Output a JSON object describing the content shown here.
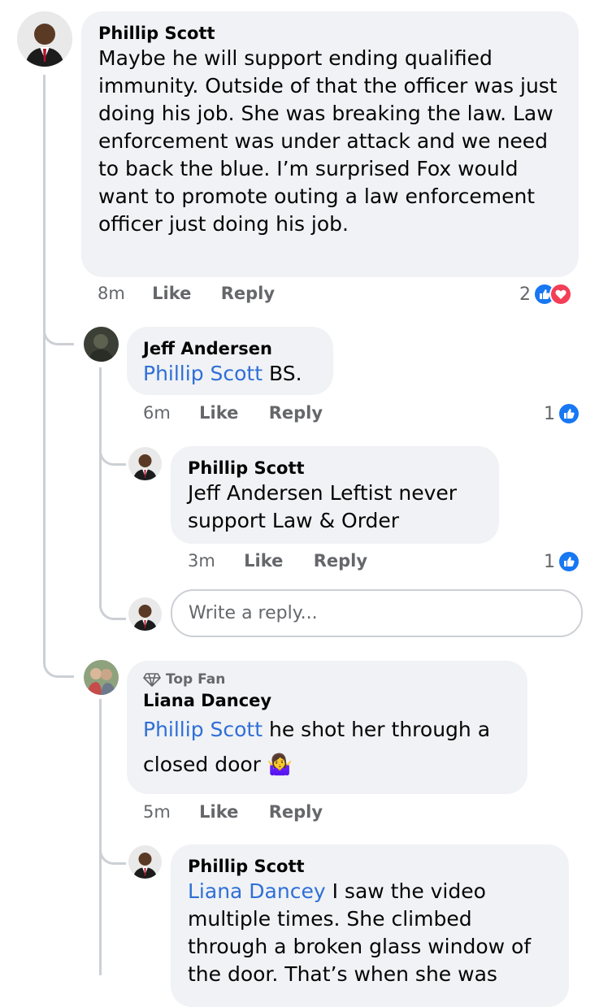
{
  "comments": {
    "c1": {
      "author": "Phillip Scott",
      "text": "Maybe he will support ending qualified immunity. Outside of that the officer was just doing his job. She was breaking the law. Law enforcement was under attack and we need to back the blue. I’m surprised Fox would want to promote outing a law enforcement officer just doing his job.",
      "time": "8m",
      "like": "Like",
      "reply": "Reply",
      "reaction_count": "2"
    },
    "c2": {
      "author": "Jeff Andersen",
      "mention": "Phillip Scott",
      "text": "BS.",
      "time": "6m",
      "like": "Like",
      "reply": "Reply",
      "reaction_count": "1"
    },
    "c3": {
      "author": "Phillip Scott",
      "text": "Jeff Andersen Leftist never support Law & Order",
      "time": "3m",
      "like": "Like",
      "reply": "Reply",
      "reaction_count": "1"
    },
    "c4": {
      "badge": "Top Fan",
      "author": "Liana Dancey",
      "mention": "Phillip Scott",
      "text": "he shot her through a closed door",
      "emoji": "🤷‍♀️",
      "time": "5m",
      "like": "Like",
      "reply": "Reply"
    },
    "c5": {
      "author": "Phillip Scott",
      "mention": "Liana Dancey",
      "text": "I saw the video multiple times. She climbed through a broken glass window of the door. That’s when she was"
    }
  },
  "reply_box": {
    "placeholder": "Write a reply..."
  },
  "icons": {
    "like": "thumbs-up-icon",
    "love": "heart-icon",
    "badge": "diamond-icon"
  },
  "colors": {
    "mention": "#2f6fd6",
    "like": "#1877f2",
    "love": "#f33e58",
    "bubble": "#f0f2f5"
  }
}
